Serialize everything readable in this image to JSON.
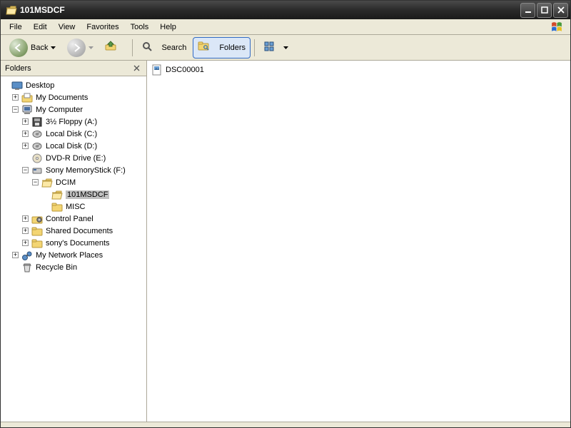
{
  "window": {
    "title": "101MSDCF"
  },
  "menu": {
    "file": "File",
    "edit": "Edit",
    "view": "View",
    "favorites": "Favorites",
    "tools": "Tools",
    "help": "Help"
  },
  "toolbar": {
    "back": "Back",
    "search": "Search",
    "folders": "Folders"
  },
  "folders_panel": {
    "title": "Folders"
  },
  "tree": {
    "desktop": "Desktop",
    "mydocs": "My Documents",
    "mycomputer": "My Computer",
    "floppy": "3½ Floppy (A:)",
    "localc": "Local Disk (C:)",
    "locald": "Local Disk (D:)",
    "dvdr": "DVD-R Drive (E:)",
    "sony": "Sony MemoryStick (F:)",
    "dcim": "DCIM",
    "m101": "101MSDCF",
    "misc": "MISC",
    "cpanel": "Control Panel",
    "shared": "Shared Documents",
    "sonydocs": "sony's Documents",
    "network": "My Network Places",
    "recycle": "Recycle Bin"
  },
  "content": {
    "file1": "DSC00001"
  }
}
